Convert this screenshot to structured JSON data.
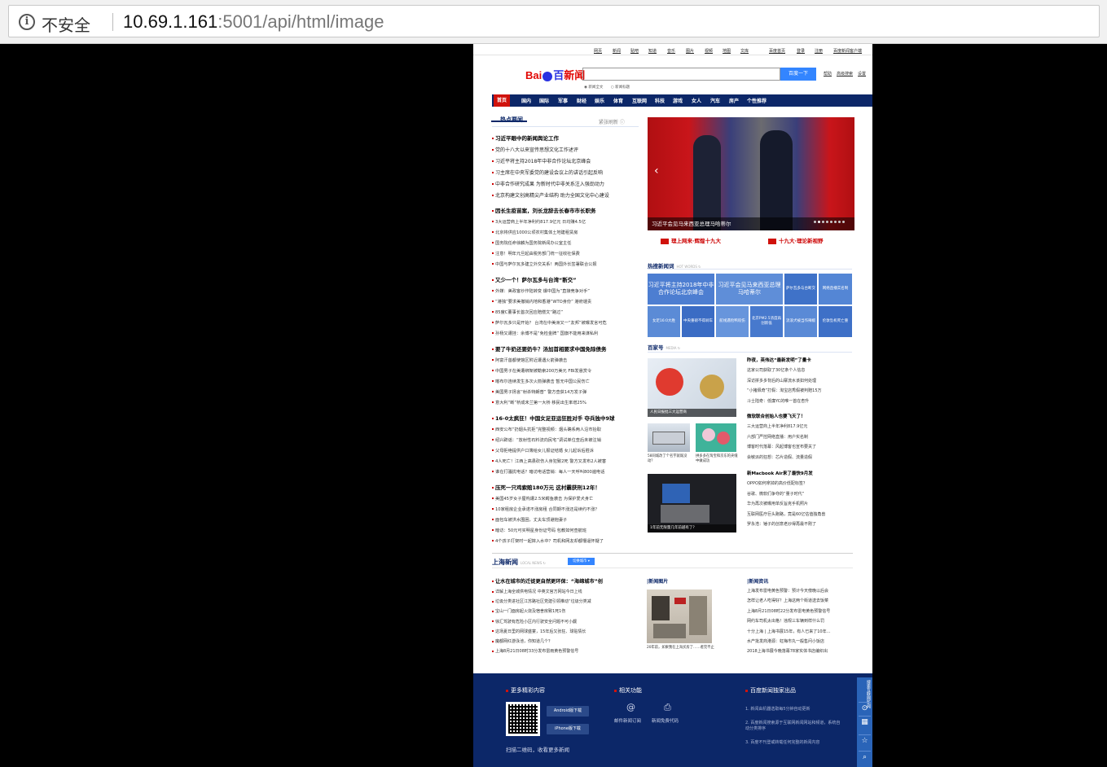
{
  "browser": {
    "security_label": "不安全",
    "url_host": "10.69.1.161",
    "url_rest": ":5001/api/html/image"
  },
  "topnav": [
    "网页",
    "新闻",
    "贴吧",
    "知道",
    "音乐",
    "图片",
    "视频",
    "地图",
    "文库",
    "百度首页",
    "登录",
    "注册",
    "百度新闻客户端"
  ],
  "search": {
    "button": "百度一下",
    "links": [
      "帮助",
      "高级搜索",
      "设置"
    ],
    "radio_fulltext": "新闻全文",
    "radio_title": "新闻标题"
  },
  "mainnav": [
    "首页",
    "国内",
    "国际",
    "军事",
    "财经",
    "娱乐",
    "体育",
    "互联网",
    "科技",
    "游戏",
    "女人",
    "汽车",
    "房产",
    "个性推荐"
  ],
  "hot": {
    "title": "热点要闻",
    "fresh": "紧张刷新 ⓘ",
    "groups": [
      {
        "lead": "习近平眼中的新闻舆论工作",
        "items": [
          "党的十八大以来宣传思想文化工作述评",
          "习近平将主持2018年中非合作论坛北京峰会",
          "习主席在中央军委党的建设会议上的讲话引起反响",
          "中非合作研究成果 为新时代中非关系注入强劲动力",
          "北京构建文创高精尖产业结构 助力全国文化中心建设"
        ]
      },
      {
        "lead": "因长生疫苗案，刘长龙辞去长春市市长职务",
        "items": [
          "3大运营商上半年净利约817.9亿元 日均赚4.5亿",
          "北京将供应1000公顷农村集体土地建租赁房",
          "国务院任命徐麟为国务院新闻办公室主任",
          "注意！明年元旦起由税务部门统一征收社保费",
          "中国与萨尔瓦多建立外交关系！两国外长签署联合公报"
        ]
      },
      {
        "lead": "又少一个！萨尔瓦多与台湾“断交”",
        "items": [
          "外媒：美政客炒作陆转变 爆中国为“直接竞争对手”",
          "“港独”要求美撤销内地和香港“WTO身份” 港府谴责",
          "85度C董事长首次回应赔偿文“路过”",
          "萨尔瓦多只是开始？ 台湾在中美洲又一“友邦”被曝发言可危",
          "孙杨又遭挂：余博不是“免检金牌” 国旗不能用来谋私利"
        ]
      },
      {
        "lead": "要了牛奶还要奶牛？汤加首相要求中国免除债务",
        "items": [
          "阿富汗首都使馆区附近遭遇火箭弹袭击",
          "中国男子在美遭绑架被勒索200万美元 FBI发悬赏令",
          "喀布尔连续发生多次火箭弹袭击 暂无中国公民伤亡",
          "美国男子扬言“射杀特朗普” 警方查获14万发子弹",
          "意大利“断”桥成未兰第一大桥 移民出生率增25%"
        ]
      },
      {
        "lead": "16-0太疯狂！中国女足亚运狂胜对手 夺兵独中9球",
        "items": [
          "西安公布“扔烟头抗拒”完整视频：烟头确系两人沿市抬取",
          "绍兴辟谣：“放射性石料流向民宅”调试单位查后未被注销",
          "父母拒绝提供户口簿给女儿报证结婚 女儿起诉后胜诉",
          "4人死亡！江西上高县砍伤人身犯致2死 警方又发布2人被害",
          "谁在打骚扰电话？暗访电话营销：每人一天呼叫800遍电话"
        ]
      },
      {
        "lead": "压死一只鸡索赔180万元 这村霸获刑12年！",
        "items": [
          "美国45岁女子屋构遭2.5米鳄鱼袭击 为保护爱犬身亡",
          "10家租房企业承诺不涨房租 合同期不涨还是续约不涨？",
          "面包车被洪水围困，丈夫车顶避抱妻子",
          "暗访：50元可买明星身份证号码 包教如何查航班",
          "4个孩子打架时一起摔入水中？司机和网友却都懵逼怀疑了"
        ]
      }
    ]
  },
  "carousel": {
    "caption": "习近平会见马来西亚总理马哈蒂尔",
    "dots": 8,
    "active_dot": 1
  },
  "promos": [
    "理上网来·辉煌十九大",
    "十九大·理论新视野"
  ],
  "hotwords": {
    "title": "热搜新闻词",
    "sub": "HOT WORDS ↻",
    "tiles": [
      "习近平将主持2018年中非合作论坛北京峰会",
      "习近平会见马来西亚总理马哈蒂尔",
      "萨尔瓦多与台断交",
      "网络直播实名制",
      "女足16:0大胜",
      "中央重磅不得刹车",
      "航线遇险鸭咬伤",
      "北京PM2.5浓度再创新低",
      "流浪犬被当作辣椒",
      "伦敦坠机死亡重"
    ]
  },
  "baijiahao": {
    "title": "百家号",
    "sub": "MEDIA ↻",
    "img1_caption": "人民日报批三大运营商",
    "img2_caption": "58同城改了个名字就既没动？",
    "img3_caption": "拼多多在淘宝和京东的夹缝中做成功",
    "img4_caption": "1年前无限量几年前越有了？",
    "group1": {
      "lead": "昨夜，英伟达“最新发明”了量卡",
      "items": [
        "这家公司获取了30亿条个人信息",
        "深访拼多多背后的山寨流水该如何处理",
        "“小猪佩奇”打假：淘宝店秀假被判赔15万",
        "斗士陆奇：低廉YC的唯一首在杏升"
      ]
    },
    "group2": {
      "lead": "微软联合创始人也要飞天了！",
      "items": [
        "三大运营商上半年净利817.9亿元",
        "六部门严控网络直播：用户实名制",
        "博客时代落幕：风起博客也宣布要关了",
        "会敏派的狂想：芯片造假、流量造假"
      ]
    },
    "group3": {
      "lead": "新Macbook Air来了最快9月发",
      "items": [
        "OPPO如何拿掉的高价低配标签？",
        "谷歌、微软们争夺的“量子时代”",
        "华为再次被曝用单反旨克手机照片",
        "互联网医疗巨头跑路，竟是60亿估值独角兽",
        "罗永浩：锤子的创意老炒得再最不刚了"
      ]
    }
  },
  "shanghai": {
    "title": "上海新闻",
    "sub": "LOCAL NEWS ↻",
    "switch_btn": "切换城市 ▾",
    "col_titles": [
      "新闻图片",
      "新闻资讯"
    ],
    "lead": "让水在城市的迁徙更自然更环保：“海绵城市”创",
    "items": [
      "详解上海全城供电情况 中英文官方网站今日上线",
      "垃圾分类进社区江苏路社区党建引领推动“垃圾分类减",
      "宝山一门面房起火烧及宿舍房致1死1伤",
      "徐汇驾驶有危险小区内行驶安全问题不可小觑",
      "这场夏日里的网球盛宴，15年后又张狂、球贴情长",
      "魔都网红游泳池，你知道几个？",
      "上海8月21日08时33分发布雷雨黄色预警信号"
    ],
    "photo_caption": "20年前，如果我在上海买房了……者完不止",
    "news": [
      "上海发布雷电黄色预警：预计今天傍晚以后会",
      "怎样让老人吃得好？上海这两个街道送去饭菜",
      "上海8月21日08时22分发布雷电黄色预警信号",
      "网约车司机太出格！违规三车辆到样什么罚",
      "十分上海 | 上海书展15年，有人已来了10年…",
      "水产批发商港源：虹梅市丸一般售问小饭店",
      "2018上海书展今晚落幕78家实体书店编织出"
    ]
  },
  "footer": {
    "more_title": "更多精彩内容",
    "android": "Android版下载",
    "iphone": "iPhone版下载",
    "scan": "扫描二维码，收看更多新闻",
    "func_title": "相关功能",
    "func1": "邮件新闻订阅",
    "func2": "新闻免费代码",
    "excl_title": "百度新闻独家出品",
    "excl": [
      "1. 新闻由机器选取每5分钟自动更新",
      "2. 百度新闻搜索源于互联网新闻网站和频道，系统自动分类排序",
      "3. 百度不刊登或转载任何完整的新闻内容"
    ]
  },
  "sidebar": {
    "label": "搜索互联网新闻"
  }
}
